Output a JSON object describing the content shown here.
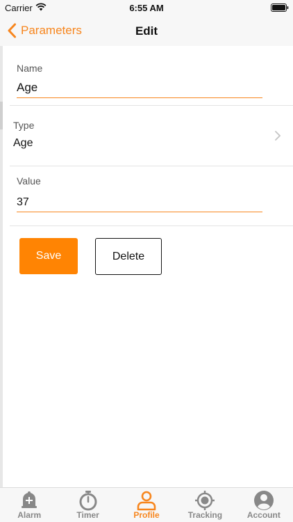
{
  "status_bar": {
    "carrier": "Carrier",
    "time": "6:55 AM"
  },
  "nav": {
    "back_label": "Parameters",
    "title": "Edit"
  },
  "form": {
    "name": {
      "label": "Name",
      "value": "Age"
    },
    "type": {
      "label": "Type",
      "value": "Age"
    },
    "value": {
      "label": "Value",
      "value": "37"
    }
  },
  "actions": {
    "save_label": "Save",
    "delete_label": "Delete"
  },
  "tabs": [
    {
      "label": "Alarm",
      "icon": "alarm-bell-icon",
      "active": false
    },
    {
      "label": "Timer",
      "icon": "stopwatch-icon",
      "active": false
    },
    {
      "label": "Profile",
      "icon": "profile-icon",
      "active": true
    },
    {
      "label": "Tracking",
      "icon": "target-icon",
      "active": false
    },
    {
      "label": "Account",
      "icon": "account-icon",
      "active": false
    }
  ],
  "colors": {
    "accent": "#f7861e",
    "save_button": "#ff8403",
    "inactive_tab": "#888888"
  }
}
